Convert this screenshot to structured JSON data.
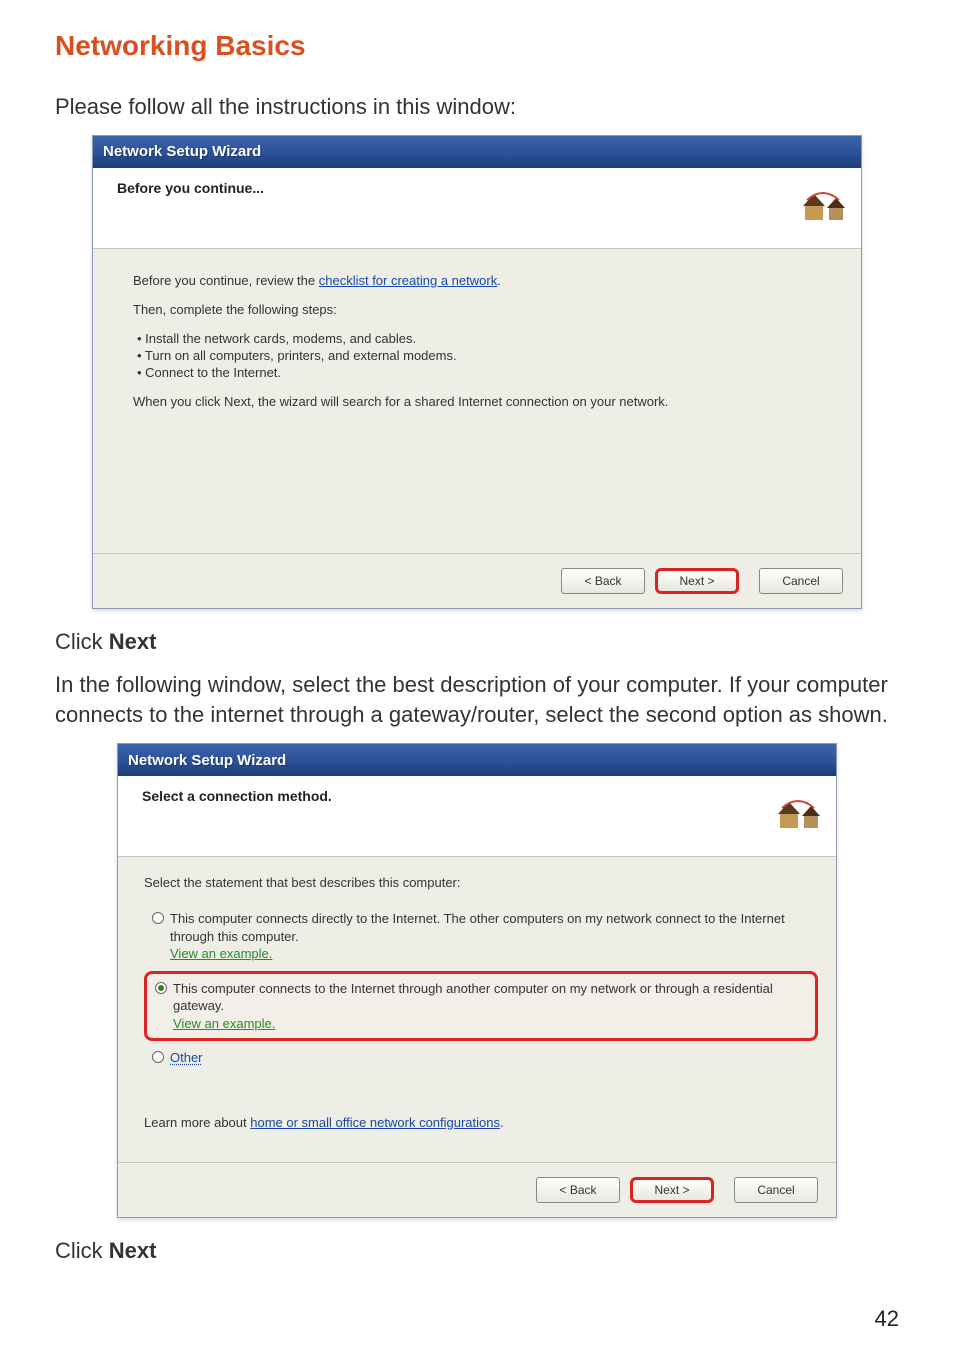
{
  "page": {
    "title": "Networking Basics",
    "intro": "Please follow all the instructions in this window:",
    "click_next_1": "Click ",
    "click_next_bold": "Next",
    "para2": "In the following window, select the best description of your computer.  If your computer connects to the internet through a gateway/router, select the second option as shown.",
    "click_next_2": "Click ",
    "page_number": "42"
  },
  "wizard1": {
    "titlebar": "Network Setup Wizard",
    "header_title": "Before you continue...",
    "line_before": "Before you continue, review the ",
    "link_checklist": "checklist for creating a network",
    "line_then": "Then, complete the following steps:",
    "step1": "•  Install the network cards, modems, and cables.",
    "step2": "•  Turn on all computers, printers, and external modems.",
    "step3": "•  Connect to the Internet.",
    "line_when": "When you click Next, the wizard will search for a shared Internet connection on your network.",
    "btn_back": "< Back",
    "btn_next": "Next >",
    "btn_cancel": "Cancel"
  },
  "wizard2": {
    "titlebar": "Network Setup Wizard",
    "header_title": "Select a connection method.",
    "line_select": "Select the statement that best describes this computer:",
    "opt1_text": "This computer connects directly to the Internet. The other computers on my network connect to the Internet through this computer.",
    "opt1_link": "View an example.",
    "opt2_text": "This computer connects to the Internet through another computer on my network or through a residential gateway.",
    "opt2_link": "View an example.",
    "opt3_text": "Other",
    "learn_more_prefix": "Learn more about ",
    "learn_more_link": "home or small office network configurations",
    "btn_back": "< Back",
    "btn_next": "Next >",
    "btn_cancel": "Cancel"
  },
  "colors": {
    "accent_orange": "#d94f1f",
    "highlight_red": "#d22",
    "titlebar_blue": "#2a4f94"
  }
}
